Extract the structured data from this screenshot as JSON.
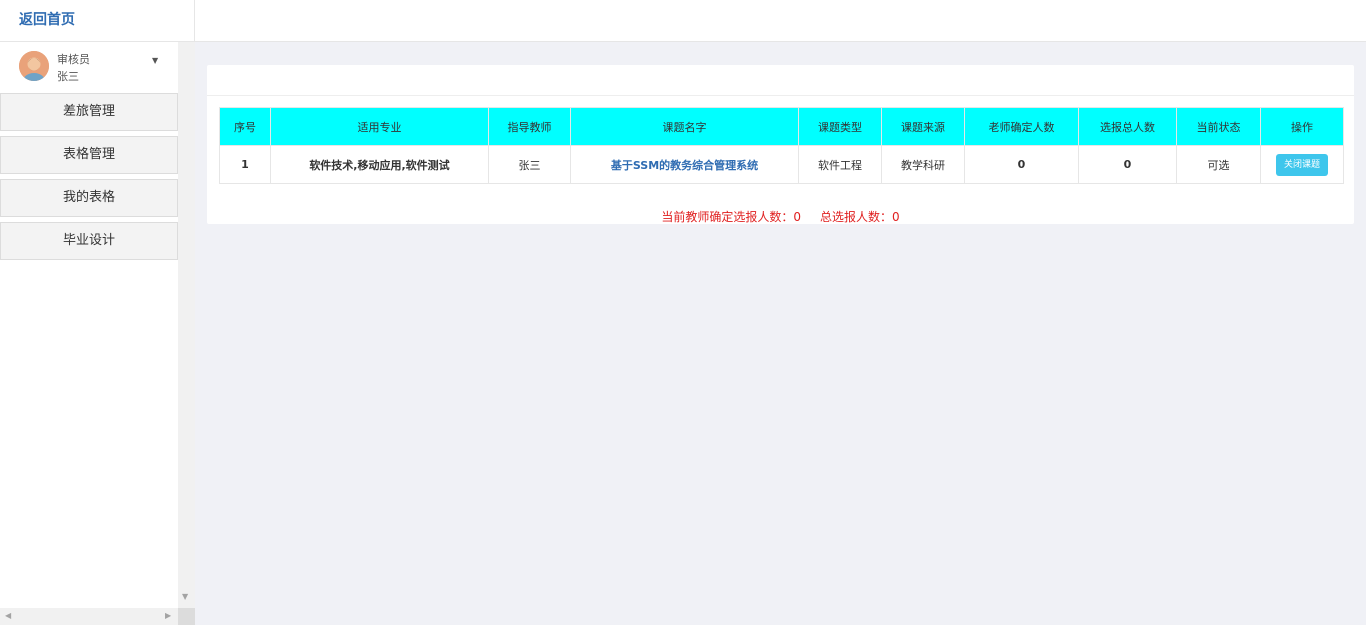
{
  "topbar": {
    "home_link": "返回首页"
  },
  "user": {
    "role": "审核员",
    "name": "张三"
  },
  "menu": [
    {
      "label": "差旅管理"
    },
    {
      "label": "表格管理"
    },
    {
      "label": "我的表格"
    },
    {
      "label": "毕业设计"
    }
  ],
  "table": {
    "headers": [
      "序号",
      "适用专业",
      "指导教师",
      "课题名字",
      "课题类型",
      "课题来源",
      "老师确定人数",
      "选报总人数",
      "当前状态",
      "操作"
    ],
    "rows": [
      {
        "index": "1",
        "majors": "软件技术,移动应用,软件测试",
        "teacher": "张三",
        "topic": "基于SSM的教务综合管理系统",
        "type": "软件工程",
        "source": "教学科研",
        "confirmed": "0",
        "total": "0",
        "status": "可选",
        "action": "关闭课题"
      }
    ]
  },
  "summary": {
    "confirmed_text": "当前教师确定选报人数：0",
    "total_text": "总选报人数：0"
  },
  "colors": {
    "header_bg": "#00ffff",
    "link": "#2f6cb2",
    "button": "#3ec6ec",
    "summary_text": "#e02020"
  }
}
